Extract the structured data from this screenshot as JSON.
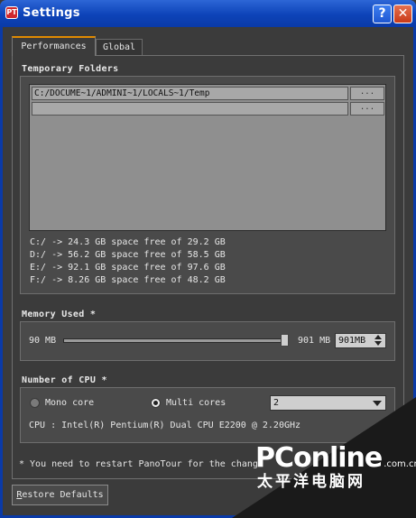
{
  "window": {
    "icon_text": "PT",
    "title": "Settings",
    "help_label": "?",
    "close_label": "✕"
  },
  "tabs": [
    {
      "label": "Performances",
      "active": true
    },
    {
      "label": "Global",
      "active": false
    }
  ],
  "temp_folders": {
    "title": "Temporary Folders",
    "paths": [
      {
        "value": "C:/DOCUME~1/ADMINI~1/LOCALS~1/Temp",
        "browse_label": "..."
      },
      {
        "value": "",
        "browse_label": "..."
      }
    ],
    "disks": [
      "C:/ -> 24.3 GB space free of 29.2 GB",
      "D:/ -> 56.2 GB space free of 58.5 GB",
      "E:/ -> 92.1 GB space free of 97.6 GB",
      "F:/ -> 8.26 GB space free of 48.2 GB"
    ]
  },
  "memory": {
    "title": "Memory Used *",
    "min_label": "90 MB",
    "max_label": "901 MB",
    "spin_value": "901MB",
    "slider_fraction": 1.0
  },
  "cpu": {
    "title": "Number of CPU *",
    "mono_label": "Mono core",
    "multi_label": "Multi cores",
    "selected": "multi",
    "cores_value": "2",
    "info": "CPU : Intel(R) Pentium(R) Dual  CPU  E2200  @ 2.20GHz"
  },
  "footer": {
    "note": "* You need to restart PanoTour for the changes to take effect",
    "restore_label": "Restore Defaults",
    "restore_mnemonic": "R"
  },
  "watermark": {
    "logo": "PConline",
    "domain": ".com.cn",
    "chinese": "太平洋电脑网"
  }
}
